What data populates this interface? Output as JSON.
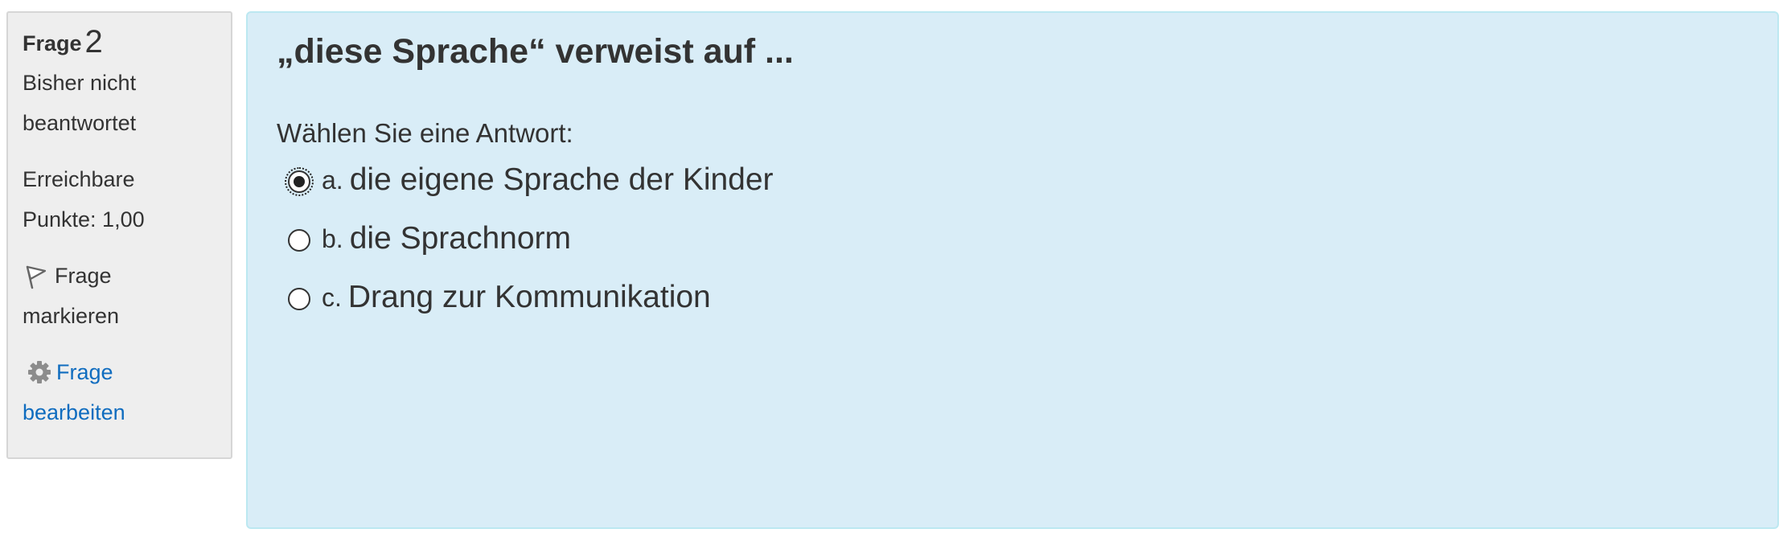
{
  "info": {
    "question_label": "Frage",
    "question_number": "2",
    "status_line1": "Bisher nicht",
    "status_line2": "beantwortet",
    "points_line1": "Erreichbare",
    "points_line2": "Punkte: 1,00",
    "flag_line1": "Frage",
    "flag_line2": "markieren",
    "edit_line1": "Frage",
    "edit_line2": "bearbeiten",
    "flag_icon": "flag-icon",
    "edit_icon": "gear-icon"
  },
  "question": {
    "text": "„diese Sprache“ verweist auf ...",
    "prompt": "Wählen Sie eine Antwort:",
    "options": [
      {
        "letter": "a.",
        "text": "die eigene Sprache der Kinder",
        "selected": true
      },
      {
        "letter": "b.",
        "text": "die Sprachnorm",
        "selected": false
      },
      {
        "letter": "c.",
        "text": "Drang zur Kommunikation",
        "selected": false
      }
    ]
  },
  "colors": {
    "info_background": "#eeeeee",
    "content_background": "#d9edf7",
    "content_border": "#bce8f1",
    "link": "#0f6cbf",
    "text": "#333333"
  }
}
